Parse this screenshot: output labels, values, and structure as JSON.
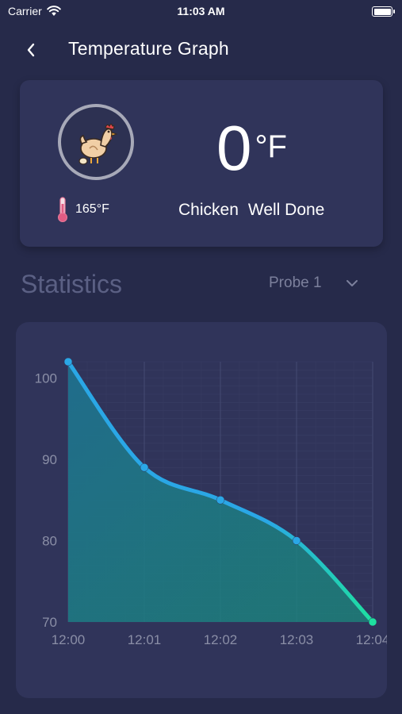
{
  "status_bar": {
    "carrier": "Carrier",
    "time": "11:03 AM"
  },
  "nav": {
    "title": "Temperature Graph"
  },
  "probe_card": {
    "target_temp": "165°F",
    "current_value": "0",
    "current_unit": "°F",
    "food": "Chicken",
    "doneness": "Well Done"
  },
  "statistics": {
    "title": "Statistics",
    "probe_selected": "Probe 1"
  },
  "colors": {
    "line_start": "#2aa7e6",
    "line_end": "#1ee0a0",
    "background": "#262a4a",
    "card": "#30345a"
  },
  "chart_data": {
    "type": "area",
    "x": [
      "12:00",
      "12:01",
      "12:02",
      "12:03",
      "12:04"
    ],
    "series": [
      {
        "values": [
          102,
          89,
          85,
          80,
          70
        ]
      }
    ],
    "y_ticks": [
      100,
      90,
      80,
      70
    ],
    "ylim": [
      70,
      102
    ],
    "grid": true,
    "title": "",
    "xlabel": "",
    "ylabel": ""
  }
}
